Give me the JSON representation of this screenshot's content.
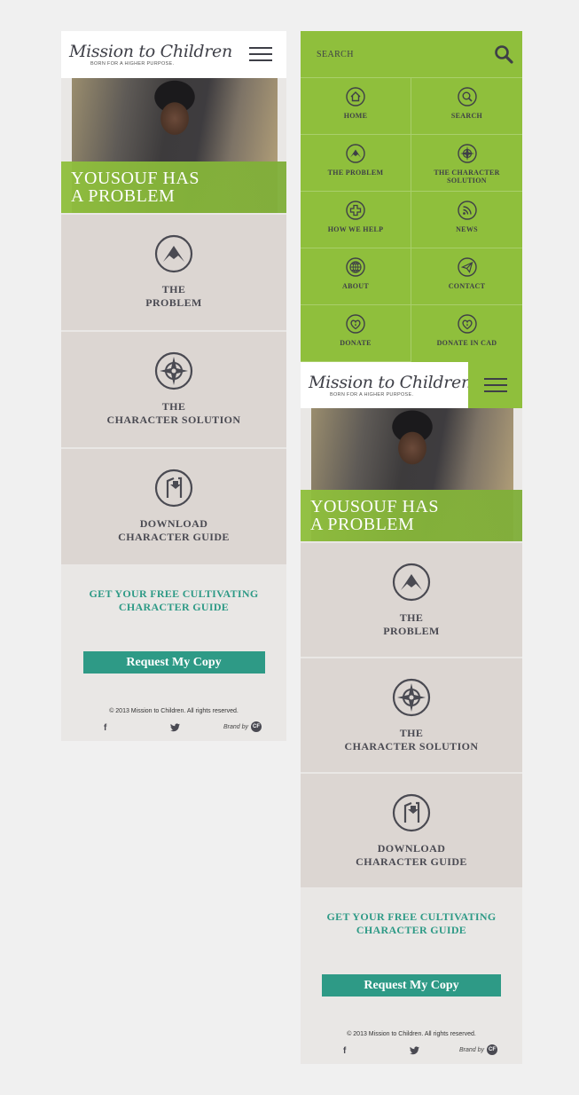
{
  "brand": {
    "logo_text": "Mission to Children",
    "tagline": "BORN FOR A HIGHER PURPOSE."
  },
  "hero": {
    "title": "YOUSOUF HAS\nA PROBLEM"
  },
  "tiles": [
    {
      "label": "THE\nPROBLEM",
      "icon": "mountain-icon"
    },
    {
      "label": "THE\nCHARACTER SOLUTION",
      "icon": "compass-icon"
    },
    {
      "label": "DOWNLOAD\nCHARACTER GUIDE",
      "icon": "download-icon"
    }
  ],
  "promo": {
    "title": "GET YOUR FREE CULTIVATING\nCHARACTER GUIDE",
    "cta_label": "Request My Copy"
  },
  "footer": {
    "copyright": "© 2013 Mission to Children. All rights reserved.",
    "facebook_glyph": "f",
    "brand_by": "Brand by",
    "brand_badge": "CF"
  },
  "menu": {
    "search_placeholder": "SEARCH",
    "items": [
      {
        "label": "HOME",
        "icon": "home-icon"
      },
      {
        "label": "SEARCH",
        "icon": "search-icon"
      },
      {
        "label": "THE PROBLEM",
        "icon": "mountain-icon"
      },
      {
        "label": "THE CHARACTER\nSOLUTION",
        "icon": "compass-icon"
      },
      {
        "label": "HOW WE HELP",
        "icon": "cross-icon"
      },
      {
        "label": "NEWS",
        "icon": "rss-icon"
      },
      {
        "label": "ABOUT",
        "icon": "globe-icon"
      },
      {
        "label": "CONTACT",
        "icon": "paper-plane-icon"
      },
      {
        "label": "DONATE",
        "icon": "heart-drop-icon"
      },
      {
        "label": "DONATE IN CAD",
        "icon": "heart-drop-icon"
      }
    ]
  },
  "colors": {
    "green": "#8fbf3c",
    "teal": "#2e9a86",
    "tile": "#dcd6d2",
    "ink": "#4a4a52"
  }
}
